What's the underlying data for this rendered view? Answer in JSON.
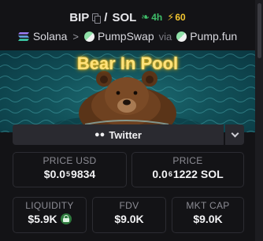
{
  "header": {
    "token_symbol": "BIP",
    "separator": "/",
    "quote_symbol": "SOL",
    "age": "4h",
    "boosts": "60",
    "chain": "Solana",
    "dex": "PumpSwap",
    "via_label": "via",
    "launchpad": "Pump.fun"
  },
  "banner": {
    "title": "Bear In Pool"
  },
  "socials": {
    "twitter_label": "Twitter"
  },
  "stats": {
    "price_usd": {
      "label": "PRICE USD",
      "prefix": "$0.0",
      "zeros": "5",
      "digits": "9834"
    },
    "price_native": {
      "label": "PRICE",
      "prefix": "0.0",
      "zeros": "6",
      "digits": "1222 SOL"
    },
    "liquidity": {
      "label": "LIQUIDITY",
      "value": "$5.9K"
    },
    "fdv": {
      "label": "FDV",
      "value": "$9.0K"
    },
    "mkt_cap": {
      "label": "MKT CAP",
      "value": "$9.0K"
    }
  },
  "colors": {
    "background": "#131316",
    "age_green": "#3fbf6a",
    "boost_yellow": "#f2c530",
    "banner_title": "#ffe27a",
    "card_border": "#2c2c32"
  },
  "icons": {
    "copy": "copy-icon",
    "age": "sprout-icon",
    "boost": "bolt-icon",
    "chain": "solana-logo-icon",
    "dex": "pumpswap-pill-icon",
    "launchpad": "pumpfun-pill-icon",
    "twitter": "people-icon",
    "expand": "chevron-down-icon",
    "liquidity_lock": "lock-icon"
  }
}
